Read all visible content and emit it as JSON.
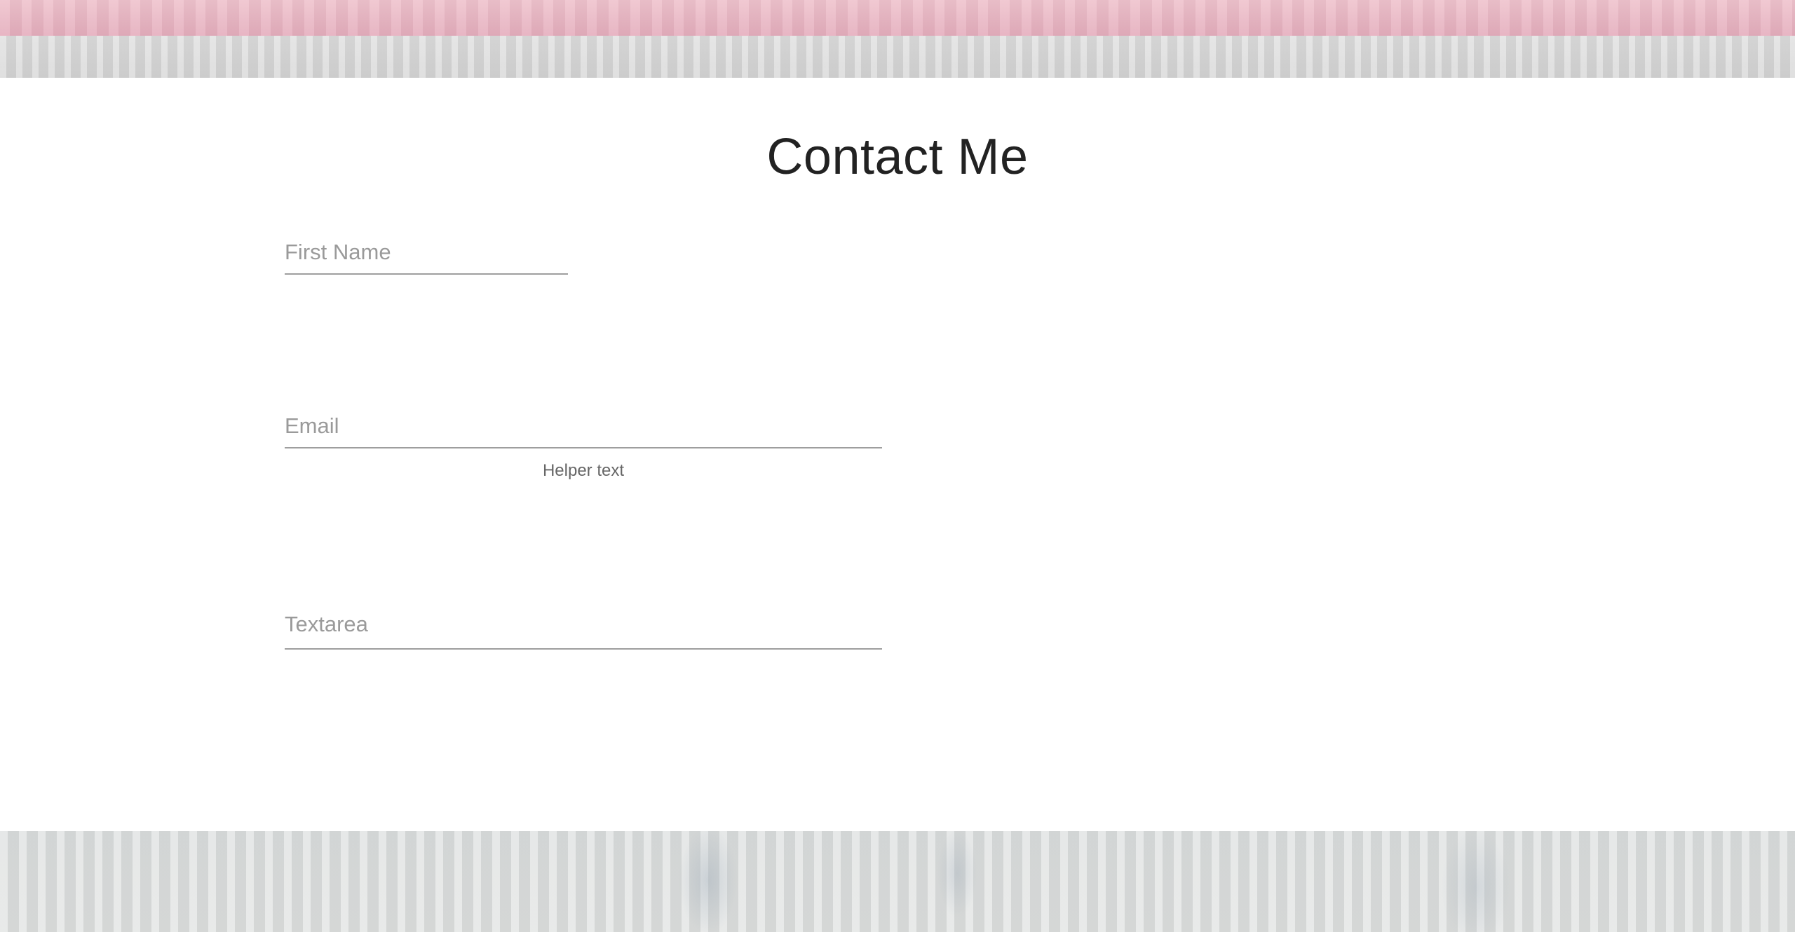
{
  "page": {
    "title": "Contact Me"
  },
  "form": {
    "first_name": {
      "placeholder": "First Name",
      "value": ""
    },
    "email": {
      "placeholder": "Email",
      "value": "",
      "helper": "Helper text"
    },
    "textarea": {
      "placeholder": "Textarea",
      "value": ""
    }
  },
  "colors": {
    "top_band": "#e9b7c4",
    "header_strip": "#d6d6d6",
    "content_bg": "#ffffff",
    "footer_band": "#dadddc",
    "title_text": "#222222",
    "placeholder_text": "#9a9a9a",
    "underline": "#9e9e9e",
    "helper_text": "#666666"
  }
}
